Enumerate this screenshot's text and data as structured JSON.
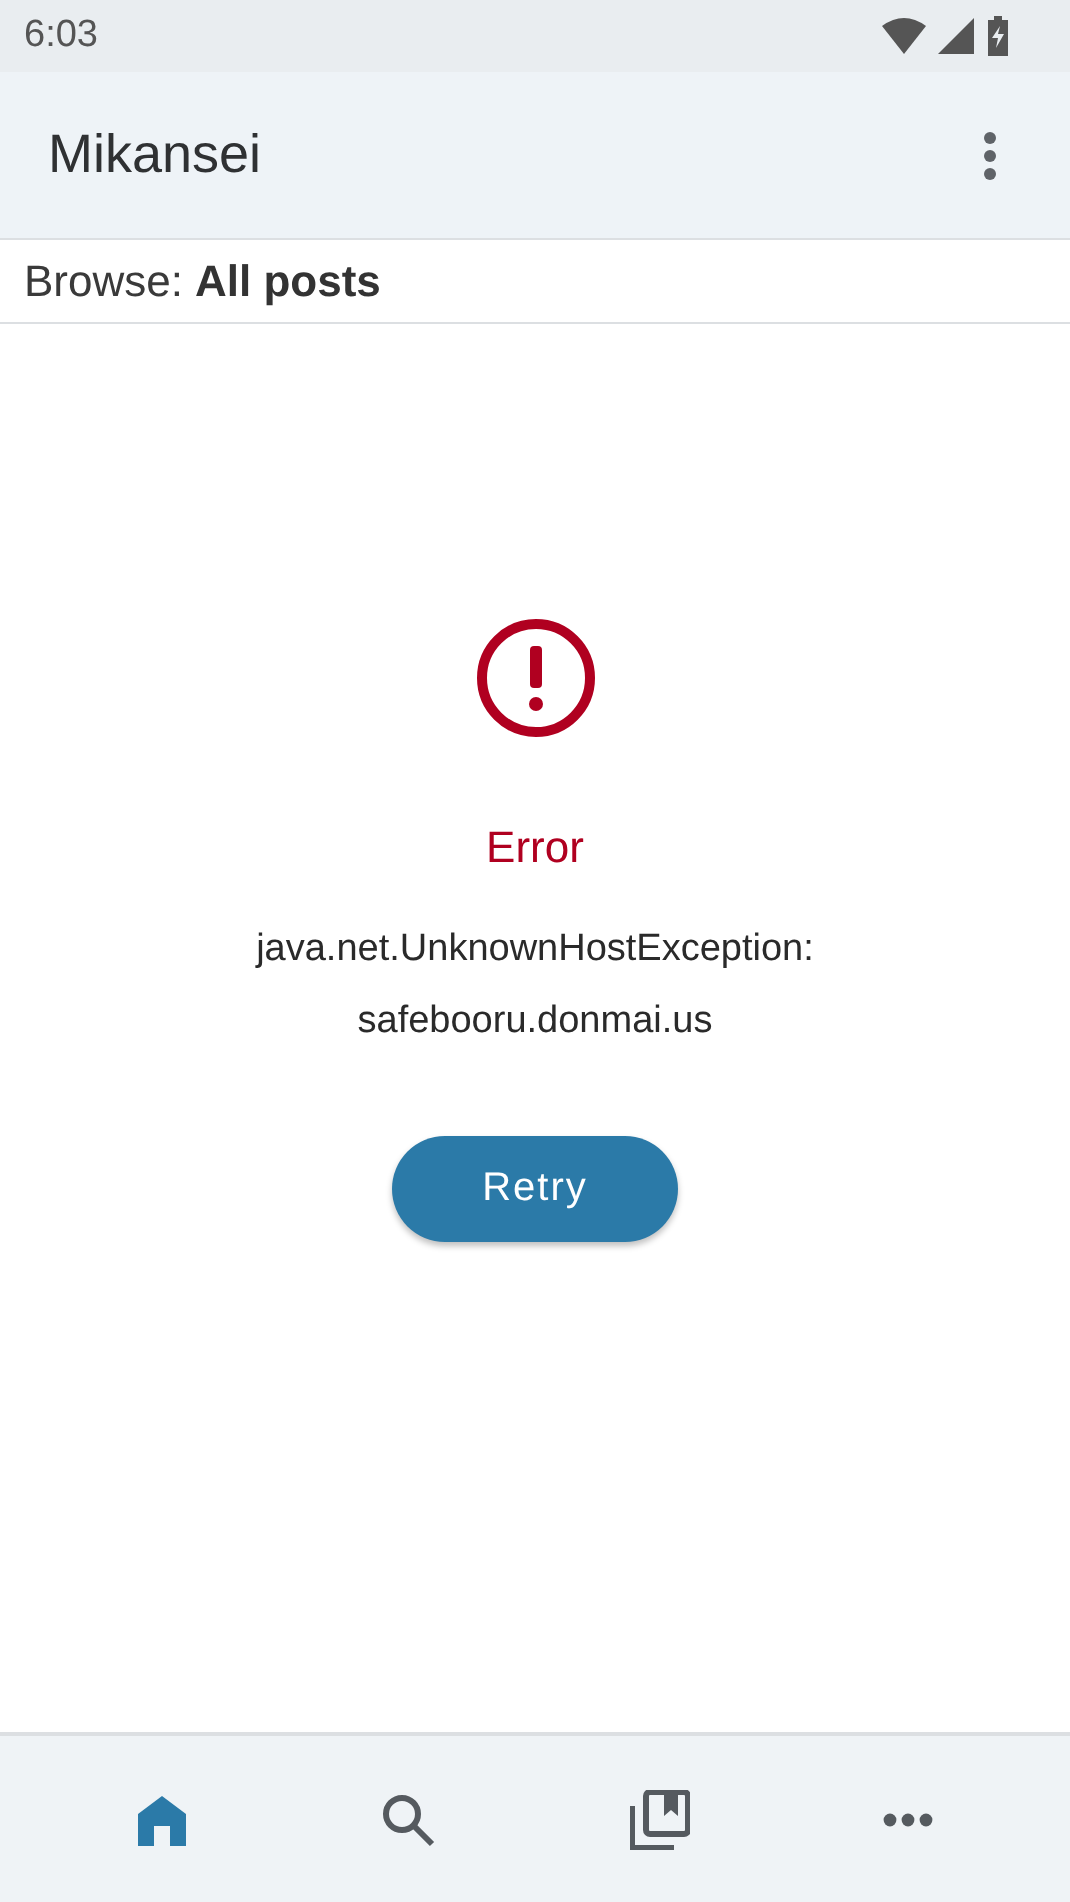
{
  "status_bar": {
    "time": "6:03"
  },
  "app_bar": {
    "title": "Mikansei"
  },
  "browse": {
    "label": "Browse:",
    "value": "All posts"
  },
  "error": {
    "title": "Error",
    "message": "java.net.UnknownHostException: safebooru.donmai.us",
    "button": "Retry"
  },
  "bottom_nav": [
    {
      "kind": "home",
      "selected": true
    },
    {
      "kind": "search",
      "selected": false
    },
    {
      "kind": "library",
      "selected": false
    },
    {
      "kind": "more",
      "selected": false
    }
  ]
}
